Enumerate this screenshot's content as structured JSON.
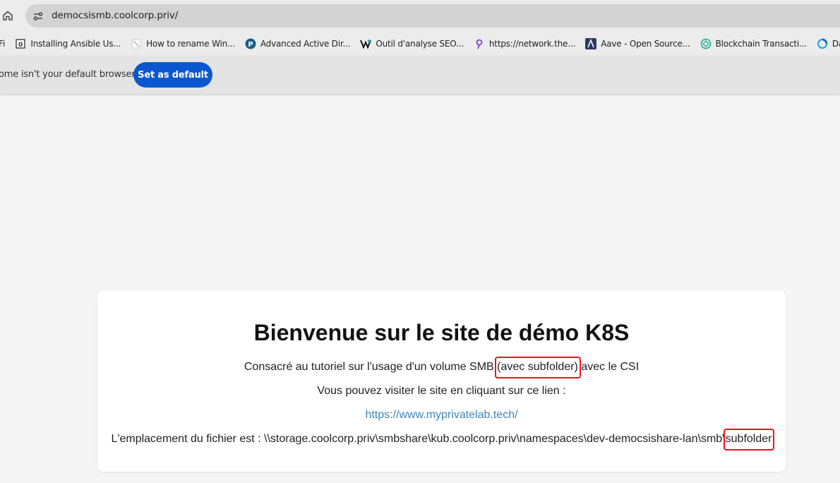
{
  "browser": {
    "url": "democsismb.coolcorp.priv/",
    "bookmarks_partial": "Fi",
    "bookmarks": [
      {
        "label": "Installing Ansible Us...",
        "icon": "page-icon"
      },
      {
        "label": "How to rename Win...",
        "icon": "page-icon"
      },
      {
        "label": "Advanced Active Dir...",
        "icon": "p-logo-icon"
      },
      {
        "label": "Outil d'analyse SEO...",
        "icon": "seo-logo-icon"
      },
      {
        "label": "https://network.the...",
        "icon": "network-logo-icon"
      },
      {
        "label": "Aave - Open Source...",
        "icon": "aave-logo-icon"
      },
      {
        "label": "Blockchain Transacti...",
        "icon": "blockchain-logo-icon"
      },
      {
        "label": "Dashboard |",
        "icon": "dashboard-logo-icon"
      }
    ],
    "infobar": {
      "message": "ome isn't your default browser",
      "button": "Set as default"
    }
  },
  "page": {
    "title": "Bienvenue sur le site de démo K8S",
    "line1_before": "Consacré au tutoriel sur l'usage d'un volume SMB ",
    "line1_highlight": "(avec subfolder)",
    "line1_after": " avec le CSI",
    "line2": "Vous pouvez visiter le site en cliquant sur ce lien :",
    "link": "https://www.myprivatelab.tech/",
    "line4_before": "L'emplacement du fichier est : \\\\storage.coolcorp.priv\\smbshare\\kub.coolcorp.priv\\namespaces\\dev-democsishare-lan\\smb\\",
    "line4_highlight": "subfolder"
  },
  "colors": {
    "accent": "#0b57d0",
    "highlight_border": "#e8141e",
    "link": "#3d86b8"
  }
}
